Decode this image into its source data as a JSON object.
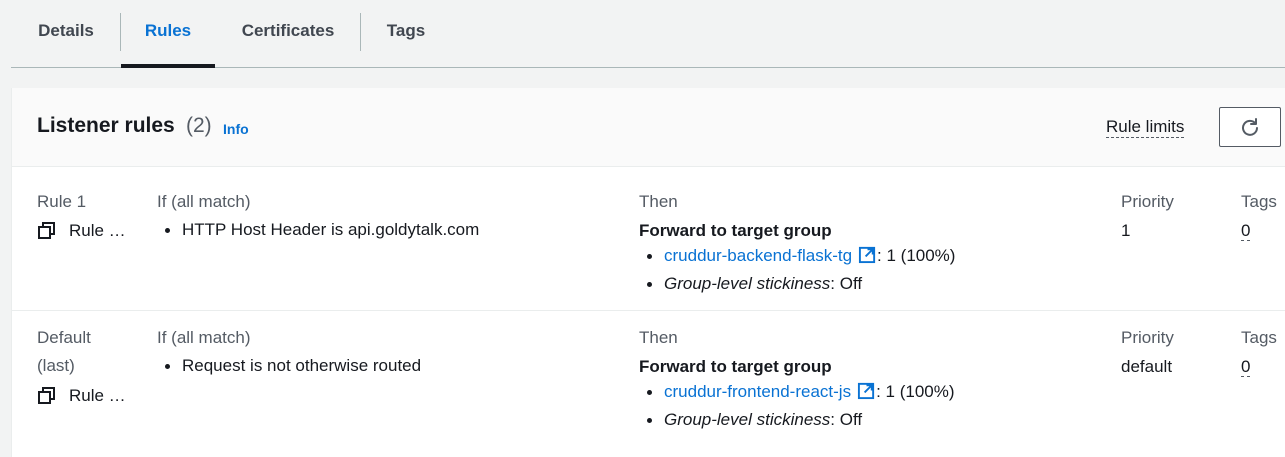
{
  "tabs": [
    {
      "label": "Details",
      "active": false
    },
    {
      "label": "Rules",
      "active": true
    },
    {
      "label": "Certificates",
      "active": false
    },
    {
      "label": "Tags",
      "active": false
    }
  ],
  "panel": {
    "title": "Listener rules",
    "count": "(2)",
    "info_label": "Info",
    "rule_limits_label": "Rule limits",
    "refresh_icon": "refresh-icon"
  },
  "rules": [
    {
      "name_line1": "Rule 1",
      "name_line2": "",
      "rule_link": "Rule …",
      "if_label": "If (all match)",
      "conditions": [
        "HTTP Host Header is api.goldytalk.com"
      ],
      "then_label": "Then",
      "action": "Forward to target group",
      "target_group": "cruddur-backend-flask-tg",
      "target_weight": ": 1 (100%)",
      "stickiness_label": "Group-level stickiness",
      "stickiness_value": ": Off",
      "priority_label": "Priority",
      "priority": "1",
      "tags_label": "Tags",
      "tags_count": "0"
    },
    {
      "name_line1": "Default",
      "name_line2": "(last)",
      "rule_link": "Rule …",
      "if_label": "If (all match)",
      "conditions": [
        "Request is not otherwise routed"
      ],
      "then_label": "Then",
      "action": "Forward to target group",
      "target_group": "cruddur-frontend-react-js",
      "target_weight": ": 1 (100%)",
      "stickiness_label": "Group-level stickiness",
      "stickiness_value": ": Off",
      "priority_label": "Priority",
      "priority": "default",
      "tags_label": "Tags",
      "tags_count": "0"
    }
  ],
  "colors": {
    "link": "#0972d3",
    "text": "#16191f",
    "muted": "#545b64",
    "border": "#eaeded",
    "background": "#f2f3f3"
  }
}
